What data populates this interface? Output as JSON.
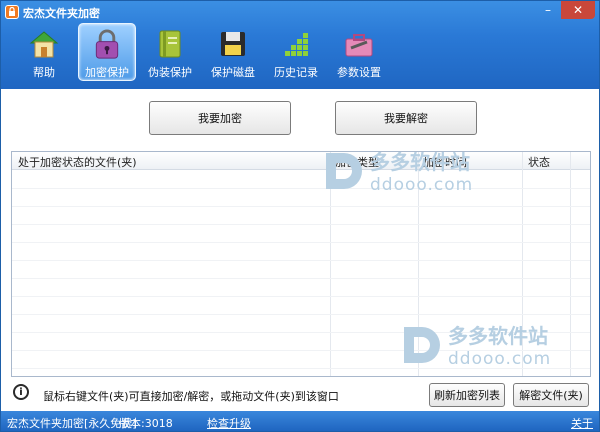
{
  "window": {
    "title": "宏杰文件夹加密"
  },
  "toolbar": {
    "items": [
      {
        "label": "帮助",
        "icon": "home-icon"
      },
      {
        "label": "加密保护",
        "icon": "lock-icon",
        "active": true
      },
      {
        "label": "伪装保护",
        "icon": "book-icon"
      },
      {
        "label": "保护磁盘",
        "icon": "floppy-disk-icon"
      },
      {
        "label": "历史记录",
        "icon": "history-grid-icon"
      },
      {
        "label": "参数设置",
        "icon": "toolbox-icon"
      }
    ]
  },
  "actions": {
    "encrypt_label": "我要加密",
    "decrypt_label": "我要解密"
  },
  "table": {
    "columns": [
      "处于加密状态的文件(夹)",
      "加密类型",
      "加密时间",
      "状态"
    ],
    "rows": []
  },
  "watermark": {
    "brand": "多多软件站",
    "url": "ddooo.com"
  },
  "footer": {
    "hint": "鼠标右键文件(夹)可直接加密/解密，或拖动文件(夹)到该窗口",
    "refresh_label": "刷新加密列表",
    "decrypt_file_label": "解密文件(夹)"
  },
  "statusbar": {
    "app_info": "宏杰文件夹加密[永久免费]",
    "version": "版本:3018",
    "check_update": "检查升级",
    "about": "关于"
  },
  "colors": {
    "accent": "#1f66c2",
    "active_tab": "#4e9be8",
    "watermark": "#b6cfe2"
  }
}
